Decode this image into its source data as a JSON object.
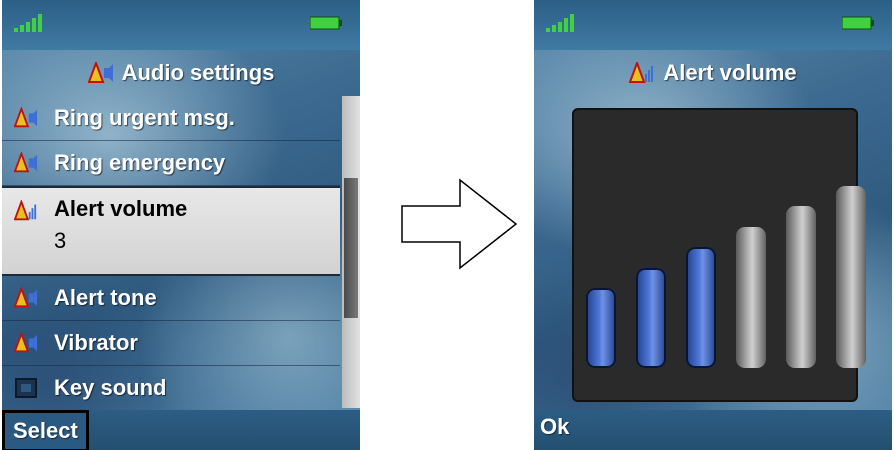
{
  "left_screen": {
    "title": "Audio settings",
    "menu_items": [
      {
        "label": "Ring urgent msg.",
        "icon": "alert-speaker-icon"
      },
      {
        "label": "Ring emergency",
        "icon": "alert-speaker-icon"
      },
      {
        "label": "Alert volume",
        "value": "3",
        "icon": "alert-volume-icon",
        "selected": true
      },
      {
        "label": "Alert tone",
        "icon": "alert-speaker-icon"
      },
      {
        "label": "Vibrator",
        "icon": "alert-speaker-icon"
      },
      {
        "label": "Key sound",
        "icon": "key-sound-icon"
      }
    ],
    "softkey_left": "Select"
  },
  "right_screen": {
    "title": "Alert volume",
    "volume_level": 3,
    "volume_max": 6,
    "softkey_left": "Ok"
  },
  "colors": {
    "bar_active": "#4f79d9",
    "bar_inactive": "#bdbdbd",
    "battery": "#3fd13f",
    "signal": "#3fd13f"
  }
}
